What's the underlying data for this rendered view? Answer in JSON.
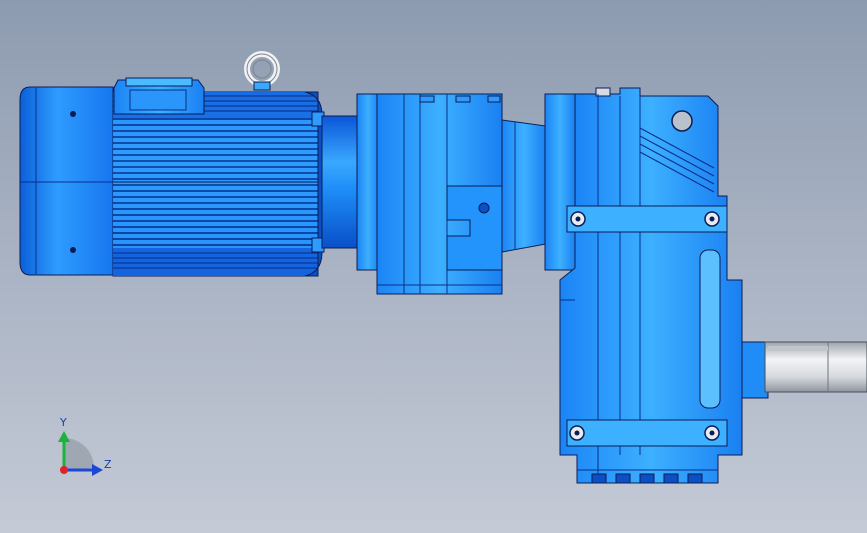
{
  "triad": {
    "y_label": "Y",
    "z_label": "Z"
  },
  "colors": {
    "body": "#1e90ff",
    "body_light": "#4fb3ff",
    "body_dark": "#0b57c9",
    "outline": "#0a1d55",
    "shaft": "#d9dde2",
    "background_top": "#8d9bb0",
    "background_bottom": "#c4cad6"
  }
}
